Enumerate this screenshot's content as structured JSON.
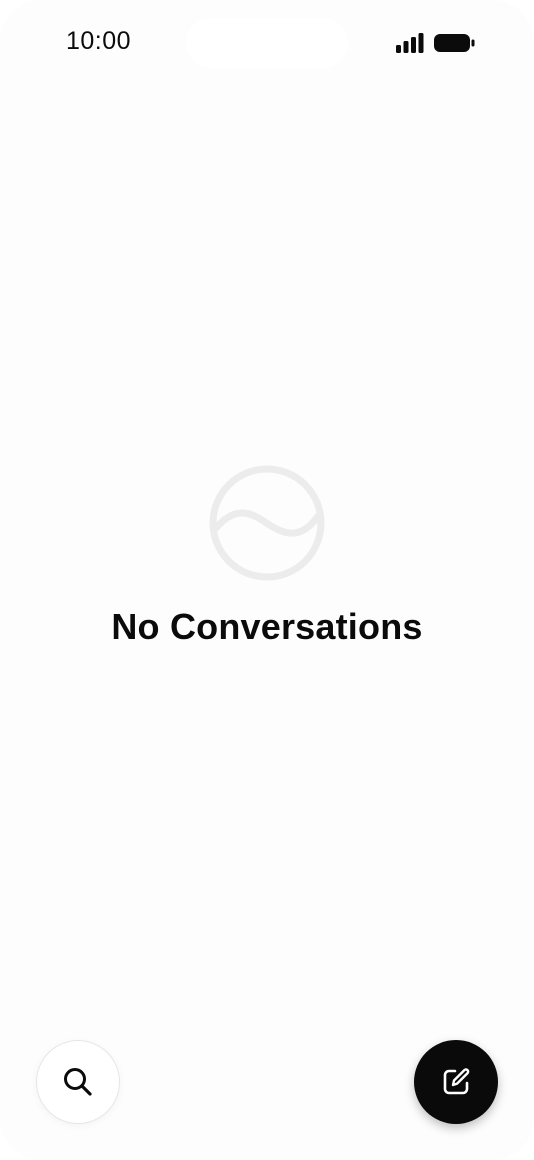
{
  "status_bar": {
    "time": "10:00",
    "signal_icon": "cellular-signal-icon",
    "battery_icon": "battery-icon"
  },
  "empty_state": {
    "icon": "logo-circle-icon",
    "title": "No Conversations"
  },
  "bottom_actions": {
    "search_icon": "search-icon",
    "compose_icon": "compose-icon"
  },
  "colors": {
    "background": "#fdfdfd",
    "text": "#0b0b0b",
    "compose_button": "#0a0a0a",
    "empty_icon": "#ececec"
  }
}
